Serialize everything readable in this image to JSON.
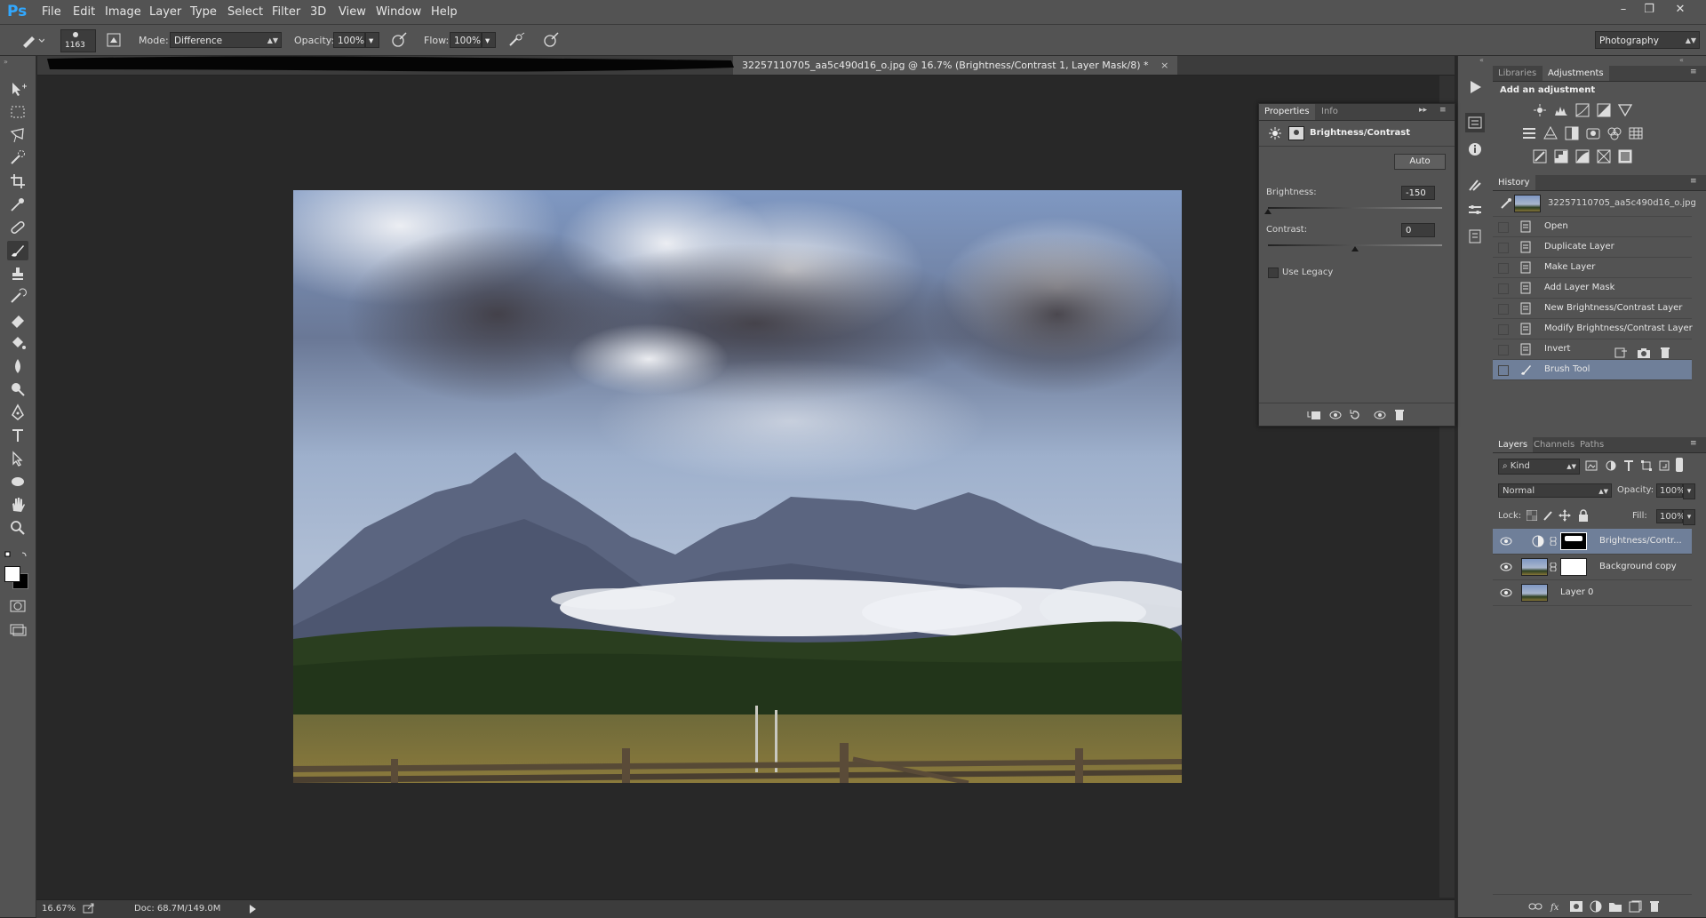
{
  "app": {
    "logo": "Ps"
  },
  "menu": [
    "File",
    "Edit",
    "Image",
    "Layer",
    "Type",
    "Select",
    "Filter",
    "3D",
    "View",
    "Window",
    "Help"
  ],
  "window_controls": {
    "minimize": "–",
    "restore": "❐",
    "close": "✕"
  },
  "options_bar": {
    "brush_size": "1163",
    "mode_label": "Mode:",
    "mode_value": "Difference",
    "opacity_label": "Opacity:",
    "opacity_value": "100%",
    "flow_label": "Flow:",
    "flow_value": "100%",
    "workspace": "Photography"
  },
  "document": {
    "tab_title": "32257110705_aa5c490d16_o.jpg @ 16.7% (Brightness/Contrast 1, Layer Mask/8) *",
    "close": "×"
  },
  "status": {
    "zoom": "16.67%",
    "doc_info": "Doc: 68.7M/149.0M"
  },
  "properties": {
    "tabs": [
      "Properties",
      "Info"
    ],
    "title": "Brightness/Contrast",
    "auto_button": "Auto",
    "brightness_label": "Brightness:",
    "brightness_value": "-150",
    "brightness_fraction": 0.0,
    "contrast_label": "Contrast:",
    "contrast_value": "0",
    "contrast_fraction": 0.5,
    "use_legacy": "Use Legacy"
  },
  "adjustments": {
    "tabs": [
      "Libraries",
      "Adjustments"
    ],
    "heading": "Add an adjustment"
  },
  "history": {
    "title": "History",
    "snapshot": "32257110705_aa5c490d16_o.jpg",
    "steps": [
      "Open",
      "Duplicate Layer",
      "Make Layer",
      "Add Layer Mask",
      "New Brightness/Contrast Layer",
      "Modify Brightness/Contrast Layer",
      "Invert",
      "Brush Tool"
    ],
    "selected_index": 7
  },
  "layers": {
    "tabs": [
      "Layers",
      "Channels",
      "Paths"
    ],
    "kind_filter": "Kind",
    "blend_mode": "Normal",
    "opacity_label": "Opacity:",
    "opacity_value": "100%",
    "lock_label": "Lock:",
    "fill_label": "Fill:",
    "fill_value": "100%",
    "items": [
      {
        "name": "Brightness/Contr...",
        "selected": true
      },
      {
        "name": "Background copy",
        "selected": false
      },
      {
        "name": "Layer 0",
        "selected": false
      }
    ]
  },
  "colors": {
    "accent": "#31a8ff",
    "panel": "#535353",
    "selection": "#6f7f99"
  }
}
